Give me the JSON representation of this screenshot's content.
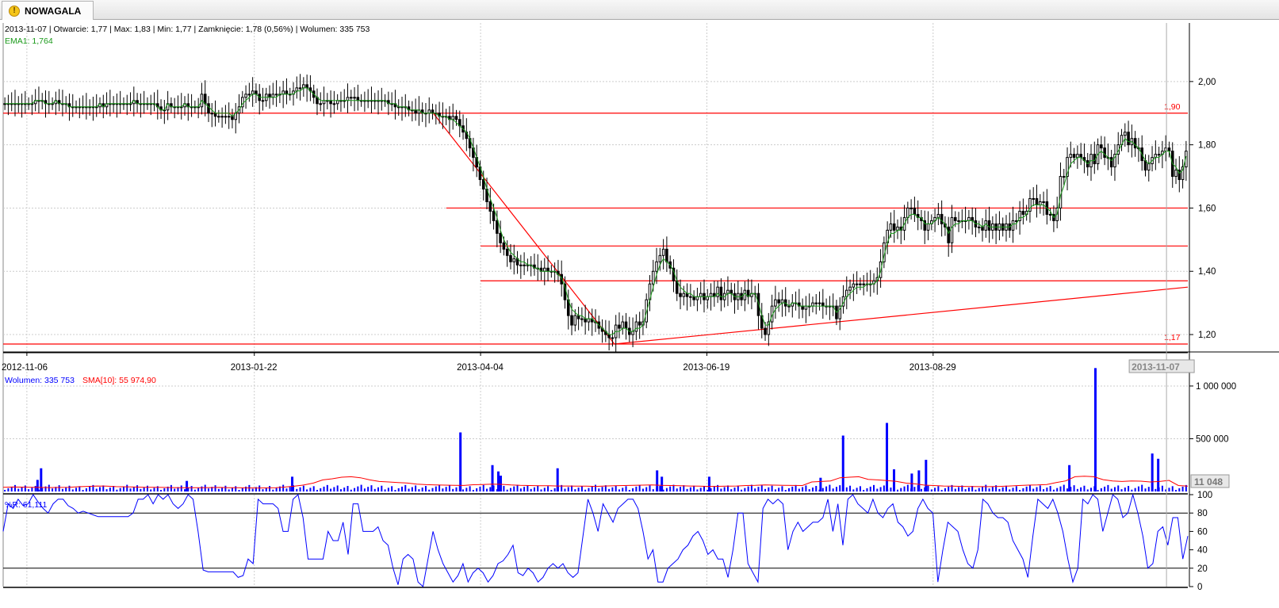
{
  "tab": {
    "title": "NOWAGALA",
    "icon": "warning-icon"
  },
  "colors": {
    "candle": "#000000",
    "ema": "#1a9a1a",
    "line": "#ff0000",
    "volume": "#0000ff",
    "sma": "#ff0000",
    "wr": "#0000ff",
    "info_black": "#000000"
  },
  "chart_data": [
    {
      "type": "candlestick",
      "info_text": "2013-11-07 | Otwarcie: 1,77 | Max: 1,83 | Min: 1,77 | Zamknięcie: 1,78 (0,56%) | Wolumen: 335 753",
      "ema_label": "EMA1: 1,764",
      "x_ticks": [
        "2012-11-06",
        "2013-01-22",
        "2013-04-04",
        "2013-06-19",
        "2013-08-29"
      ],
      "x_cursor_label": "2013-11-07",
      "y_ticks": [
        "2,00",
        "1,80",
        "1,60",
        "1,40",
        "1,20"
      ],
      "ylim": [
        1.16,
        2.14
      ],
      "hlines": [
        {
          "label": "1,90",
          "value": 1.9
        },
        {
          "label": "",
          "value": 1.6
        },
        {
          "label": "",
          "value": 1.48
        },
        {
          "label": "",
          "value": 1.37
        },
        {
          "label": "1,17",
          "value": 1.17
        }
      ],
      "trendlines": [
        {
          "from": [
            0.363,
            1.9
          ],
          "to": [
            0.516,
            1.17
          ]
        },
        {
          "from": [
            0.516,
            1.17
          ],
          "to": [
            1.0,
            1.35
          ]
        }
      ],
      "close": [
        1.93,
        1.93,
        1.93,
        1.93,
        1.93,
        1.93,
        1.93,
        1.93,
        1.93,
        1.94,
        1.94,
        1.94,
        1.93,
        1.93,
        1.93,
        1.94,
        1.93,
        1.93,
        1.93,
        1.92,
        1.92,
        1.92,
        1.92,
        1.92,
        1.92,
        1.92,
        1.92,
        1.92,
        1.93,
        1.92,
        1.93,
        1.93,
        1.93,
        1.93,
        1.93,
        1.93,
        1.93,
        1.93,
        1.94,
        1.93,
        1.93,
        1.93,
        1.93,
        1.93,
        1.93,
        1.92,
        1.91,
        1.91,
        1.93,
        1.92,
        1.92,
        1.92,
        1.92,
        1.93,
        1.92,
        1.92,
        1.92,
        1.92,
        1.96,
        1.93,
        1.9,
        1.9,
        1.89,
        1.89,
        1.89,
        1.89,
        1.89,
        1.88,
        1.9,
        1.92,
        1.95,
        1.96,
        1.96,
        1.97,
        1.96,
        1.94,
        1.94,
        1.96,
        1.95,
        1.96,
        1.96,
        1.96,
        1.97,
        1.96,
        1.96,
        1.97,
        1.98,
        1.98,
        1.99,
        1.98,
        1.97,
        1.95,
        1.93,
        1.93,
        1.94,
        1.94,
        1.93,
        1.93,
        1.94,
        1.94,
        1.94,
        1.95,
        1.95,
        1.95,
        1.94,
        1.94,
        1.94,
        1.94,
        1.94,
        1.94,
        1.94,
        1.94,
        1.94,
        1.93,
        1.93,
        1.92,
        1.92,
        1.92,
        1.92,
        1.91,
        1.91,
        1.9,
        1.91,
        1.9,
        1.9,
        1.91,
        1.9,
        1.9,
        1.89,
        1.89,
        1.89,
        1.88,
        1.89,
        1.88,
        1.86,
        1.84,
        1.82,
        1.79,
        1.76,
        1.73,
        1.69,
        1.66,
        1.62,
        1.59,
        1.56,
        1.52,
        1.49,
        1.47,
        1.45,
        1.43,
        1.44,
        1.42,
        1.42,
        1.42,
        1.42,
        1.42,
        1.41,
        1.41,
        1.4,
        1.41,
        1.4,
        1.4,
        1.4,
        1.39,
        1.36,
        1.31,
        1.26,
        1.23,
        1.26,
        1.25,
        1.25,
        1.24,
        1.25,
        1.24,
        1.24,
        1.22,
        1.21,
        1.2,
        1.19,
        1.19,
        1.23,
        1.22,
        1.24,
        1.22,
        1.2,
        1.21,
        1.24,
        1.23,
        1.24,
        1.31,
        1.36,
        1.4,
        1.43,
        1.45,
        1.47,
        1.43,
        1.41,
        1.37,
        1.33,
        1.32,
        1.33,
        1.32,
        1.32,
        1.31,
        1.32,
        1.33,
        1.31,
        1.32,
        1.33,
        1.32,
        1.35,
        1.31,
        1.33,
        1.34,
        1.33,
        1.31,
        1.33,
        1.31,
        1.34,
        1.32,
        1.33,
        1.33,
        1.26,
        1.22,
        1.2,
        1.24,
        1.29,
        1.31,
        1.3,
        1.31,
        1.29,
        1.29,
        1.3,
        1.3,
        1.29,
        1.28,
        1.29,
        1.29,
        1.3,
        1.3,
        1.3,
        1.29,
        1.29,
        1.29,
        1.29,
        1.25,
        1.29,
        1.32,
        1.34,
        1.35,
        1.36,
        1.36,
        1.36,
        1.36,
        1.36,
        1.36,
        1.37,
        1.38,
        1.43,
        1.49,
        1.53,
        1.55,
        1.53,
        1.54,
        1.53,
        1.57,
        1.6,
        1.6,
        1.58,
        1.57,
        1.56,
        1.53,
        1.55,
        1.56,
        1.57,
        1.58,
        1.55,
        1.54,
        1.49,
        1.57,
        1.56,
        1.56,
        1.56,
        1.56,
        1.57,
        1.56,
        1.54,
        1.54,
        1.53,
        1.56,
        1.53,
        1.55,
        1.53,
        1.55,
        1.53,
        1.55,
        1.53,
        1.56,
        1.56,
        1.59,
        1.58,
        1.59,
        1.63,
        1.63,
        1.61,
        1.62,
        1.62,
        1.58,
        1.58,
        1.56,
        1.6,
        1.7,
        1.7,
        1.76,
        1.77,
        1.76,
        1.77,
        1.76,
        1.75,
        1.73,
        1.77,
        1.74,
        1.8,
        1.79,
        1.76,
        1.76,
        1.73,
        1.77,
        1.8,
        1.83,
        1.84,
        1.8,
        1.82,
        1.79,
        1.79,
        1.75,
        1.72,
        1.74,
        1.76,
        1.77,
        1.77,
        1.78,
        1.79,
        1.78,
        1.7,
        1.72,
        1.69,
        1.73,
        1.78
      ],
      "ema": [
        1.93,
        1.93,
        1.93,
        1.93,
        1.93,
        1.93,
        1.93,
        1.93,
        1.93,
        1.94,
        1.94,
        1.94,
        1.93,
        1.93,
        1.93,
        1.94,
        1.93,
        1.93,
        1.93,
        1.92,
        1.92,
        1.92,
        1.92,
        1.92,
        1.92,
        1.92,
        1.92,
        1.92,
        1.93,
        1.92,
        1.93,
        1.93,
        1.93,
        1.93,
        1.93,
        1.93,
        1.93,
        1.93,
        1.94,
        1.93,
        1.93,
        1.93,
        1.93,
        1.93,
        1.93,
        1.92,
        1.91,
        1.91,
        1.93,
        1.92,
        1.92,
        1.92,
        1.92,
        1.93,
        1.92,
        1.92,
        1.92,
        1.92,
        1.94,
        1.93,
        1.92,
        1.91,
        1.9,
        1.9,
        1.9,
        1.9,
        1.9,
        1.89,
        1.9,
        1.91,
        1.93,
        1.94,
        1.95,
        1.96,
        1.96,
        1.95,
        1.95,
        1.95,
        1.95,
        1.95,
        1.95,
        1.96,
        1.96,
        1.96,
        1.96,
        1.96,
        1.97,
        1.97,
        1.98,
        1.98,
        1.97,
        1.96,
        1.95,
        1.94,
        1.94,
        1.94,
        1.94,
        1.94,
        1.94,
        1.94,
        1.94,
        1.94,
        1.94,
        1.94,
        1.94,
        1.94,
        1.94,
        1.94,
        1.94,
        1.94,
        1.94,
        1.94,
        1.94,
        1.93,
        1.93,
        1.93,
        1.92,
        1.92,
        1.92,
        1.91,
        1.91,
        1.91,
        1.91,
        1.9,
        1.9,
        1.9,
        1.9,
        1.9,
        1.89,
        1.89,
        1.89,
        1.88,
        1.88,
        1.87,
        1.86,
        1.85,
        1.84,
        1.82,
        1.79,
        1.76,
        1.73,
        1.7,
        1.66,
        1.63,
        1.6,
        1.57,
        1.53,
        1.5,
        1.48,
        1.46,
        1.45,
        1.44,
        1.43,
        1.43,
        1.42,
        1.42,
        1.41,
        1.41,
        1.4,
        1.4,
        1.4,
        1.4,
        1.4,
        1.39,
        1.38,
        1.35,
        1.31,
        1.28,
        1.27,
        1.26,
        1.26,
        1.25,
        1.25,
        1.25,
        1.24,
        1.23,
        1.22,
        1.21,
        1.2,
        1.2,
        1.21,
        1.21,
        1.22,
        1.22,
        1.21,
        1.21,
        1.22,
        1.22,
        1.23,
        1.27,
        1.31,
        1.35,
        1.39,
        1.42,
        1.44,
        1.43,
        1.42,
        1.4,
        1.37,
        1.35,
        1.34,
        1.33,
        1.33,
        1.32,
        1.32,
        1.32,
        1.32,
        1.32,
        1.32,
        1.32,
        1.33,
        1.32,
        1.32,
        1.33,
        1.33,
        1.32,
        1.32,
        1.32,
        1.33,
        1.32,
        1.33,
        1.33,
        1.3,
        1.26,
        1.23,
        1.23,
        1.26,
        1.28,
        1.29,
        1.3,
        1.3,
        1.29,
        1.3,
        1.3,
        1.29,
        1.29,
        1.29,
        1.29,
        1.29,
        1.29,
        1.29,
        1.29,
        1.29,
        1.29,
        1.29,
        1.27,
        1.28,
        1.3,
        1.32,
        1.33,
        1.34,
        1.35,
        1.35,
        1.35,
        1.36,
        1.36,
        1.36,
        1.37,
        1.4,
        1.45,
        1.49,
        1.52,
        1.52,
        1.53,
        1.53,
        1.55,
        1.57,
        1.58,
        1.58,
        1.57,
        1.57,
        1.55,
        1.55,
        1.55,
        1.56,
        1.57,
        1.56,
        1.55,
        1.52,
        1.54,
        1.55,
        1.55,
        1.56,
        1.56,
        1.56,
        1.56,
        1.55,
        1.55,
        1.54,
        1.55,
        1.54,
        1.54,
        1.54,
        1.54,
        1.54,
        1.54,
        1.54,
        1.55,
        1.55,
        1.57,
        1.57,
        1.58,
        1.6,
        1.61,
        1.61,
        1.61,
        1.61,
        1.6,
        1.59,
        1.57,
        1.58,
        1.64,
        1.67,
        1.71,
        1.74,
        1.75,
        1.76,
        1.76,
        1.75,
        1.74,
        1.75,
        1.75,
        1.77,
        1.78,
        1.77,
        1.76,
        1.75,
        1.76,
        1.78,
        1.8,
        1.82,
        1.81,
        1.81,
        1.8,
        1.79,
        1.77,
        1.75,
        1.74,
        1.75,
        1.76,
        1.76,
        1.77,
        1.78,
        1.78,
        1.74,
        1.73,
        1.71,
        1.72,
        1.764
      ]
    },
    {
      "type": "bar",
      "legend_volume": "Wolumen: 335 753",
      "legend_sma": "SMA[10]: 55 974,90",
      "y_ticks": [
        "1 000 000",
        "500 000"
      ],
      "ylim": [
        0,
        1150000
      ],
      "value_box": "11 048",
      "spikes": [
        {
          "pos": 0.032,
          "value": 220000
        },
        {
          "pos": 0.029,
          "value": 110000
        },
        {
          "pos": 0.155,
          "value": 100000
        },
        {
          "pos": 0.244,
          "value": 140000
        },
        {
          "pos": 0.386,
          "value": 560000
        },
        {
          "pos": 0.413,
          "value": 250000
        },
        {
          "pos": 0.418,
          "value": 190000
        },
        {
          "pos": 0.42,
          "value": 150000
        },
        {
          "pos": 0.468,
          "value": 220000
        },
        {
          "pos": 0.552,
          "value": 200000
        },
        {
          "pos": 0.556,
          "value": 140000
        },
        {
          "pos": 0.596,
          "value": 140000
        },
        {
          "pos": 0.69,
          "value": 130000
        },
        {
          "pos": 0.709,
          "value": 530000
        },
        {
          "pos": 0.746,
          "value": 650000
        },
        {
          "pos": 0.752,
          "value": 210000
        },
        {
          "pos": 0.767,
          "value": 170000
        },
        {
          "pos": 0.773,
          "value": 200000
        },
        {
          "pos": 0.779,
          "value": 300000
        },
        {
          "pos": 0.9,
          "value": 250000
        },
        {
          "pos": 0.922,
          "value": 1170000
        },
        {
          "pos": 0.97,
          "value": 360000
        },
        {
          "pos": 0.975,
          "value": 310000
        }
      ],
      "sma_values": [
        40000,
        42000,
        41000,
        40000,
        38000,
        37000,
        38000,
        39000,
        45000,
        48000,
        52000,
        50000,
        46000,
        44000,
        42000,
        40000,
        39000,
        38000,
        37000,
        36000,
        35000,
        36000,
        37000,
        38000,
        36000,
        35000,
        34000,
        33000,
        34000,
        36000,
        42000,
        50000,
        62000,
        80000,
        110000,
        120000,
        135000,
        140000,
        130000,
        110000,
        95000,
        90000,
        85000,
        80000,
        70000,
        65000,
        62000,
        60000,
        58000,
        57000,
        64000,
        66000,
        70000,
        68000,
        62000,
        58000,
        56000,
        55000,
        54000,
        52000,
        52000,
        51000,
        50000,
        48000,
        52000,
        54000,
        56000,
        58000,
        60000,
        62000,
        58000,
        56000,
        54000,
        52000,
        50000,
        48000,
        49000,
        50000,
        52000,
        56000,
        58000,
        62000,
        60000,
        58000,
        57000,
        56000,
        90000,
        95000,
        100000,
        130000,
        135000,
        140000,
        115000,
        110000,
        104000,
        96000,
        80000,
        72000,
        60000,
        56000,
        52000,
        50000,
        48000,
        47000,
        46000,
        46000,
        48000,
        52000,
        56000,
        60000,
        62000,
        66000,
        85000,
        100000,
        140000,
        145000,
        140000,
        112000,
        100000,
        95000,
        100000,
        98000,
        90000,
        95000,
        105000,
        56000,
        50000
      ]
    },
    {
      "type": "line",
      "legend": "%R: 61,111",
      "y_ticks": [
        "100",
        "80",
        "60",
        "40",
        "20",
        "0"
      ],
      "ylim": [
        0,
        100
      ],
      "levels": [
        80,
        20
      ],
      "values": [
        60,
        90,
        85,
        95,
        88,
        90,
        100,
        92,
        85,
        80,
        90,
        95,
        95,
        88,
        85,
        80,
        82,
        80,
        78,
        76,
        76,
        76,
        76,
        76,
        76,
        76,
        80,
        95,
        95,
        100,
        90,
        100,
        95,
        100,
        90,
        85,
        90,
        100,
        95,
        60,
        18,
        16,
        16,
        16,
        16,
        16,
        16,
        10,
        12,
        30,
        25,
        95,
        90,
        90,
        90,
        85,
        60,
        60,
        95,
        100,
        75,
        30,
        30,
        30,
        30,
        60,
        50,
        50,
        70,
        35,
        90,
        90,
        60,
        60,
        60,
        65,
        50,
        45,
        20,
        2,
        30,
        35,
        30,
        5,
        0,
        30,
        60,
        40,
        25,
        15,
        5,
        12,
        25,
        5,
        15,
        20,
        15,
        5,
        12,
        25,
        28,
        35,
        45,
        15,
        12,
        20,
        15,
        5,
        10,
        20,
        25,
        20,
        25,
        15,
        10,
        15,
        55,
        95,
        80,
        60,
        90,
        80,
        70,
        85,
        90,
        95,
        95,
        85,
        60,
        30,
        40,
        5,
        5,
        20,
        25,
        30,
        40,
        45,
        55,
        60,
        50,
        35,
        40,
        30,
        30,
        10,
        40,
        80,
        80,
        25,
        15,
        5,
        85,
        95,
        90,
        95,
        90,
        40,
        60,
        70,
        60,
        65,
        70,
        70,
        75,
        95,
        60,
        90,
        45,
        95,
        100,
        90,
        85,
        80,
        95,
        80,
        75,
        85,
        90,
        70,
        65,
        55,
        60,
        85,
        95,
        85,
        80,
        5,
        40,
        70,
        65,
        60,
        40,
        25,
        20,
        40,
        95,
        90,
        80,
        75,
        75,
        70,
        50,
        40,
        30,
        10,
        55,
        95,
        90,
        85,
        95,
        80,
        60,
        30,
        5,
        20,
        95,
        90,
        100,
        95,
        60,
        80,
        100,
        95,
        75,
        80,
        100,
        80,
        55,
        20,
        25,
        60,
        65,
        45,
        75,
        75,
        30,
        55
      ]
    }
  ]
}
